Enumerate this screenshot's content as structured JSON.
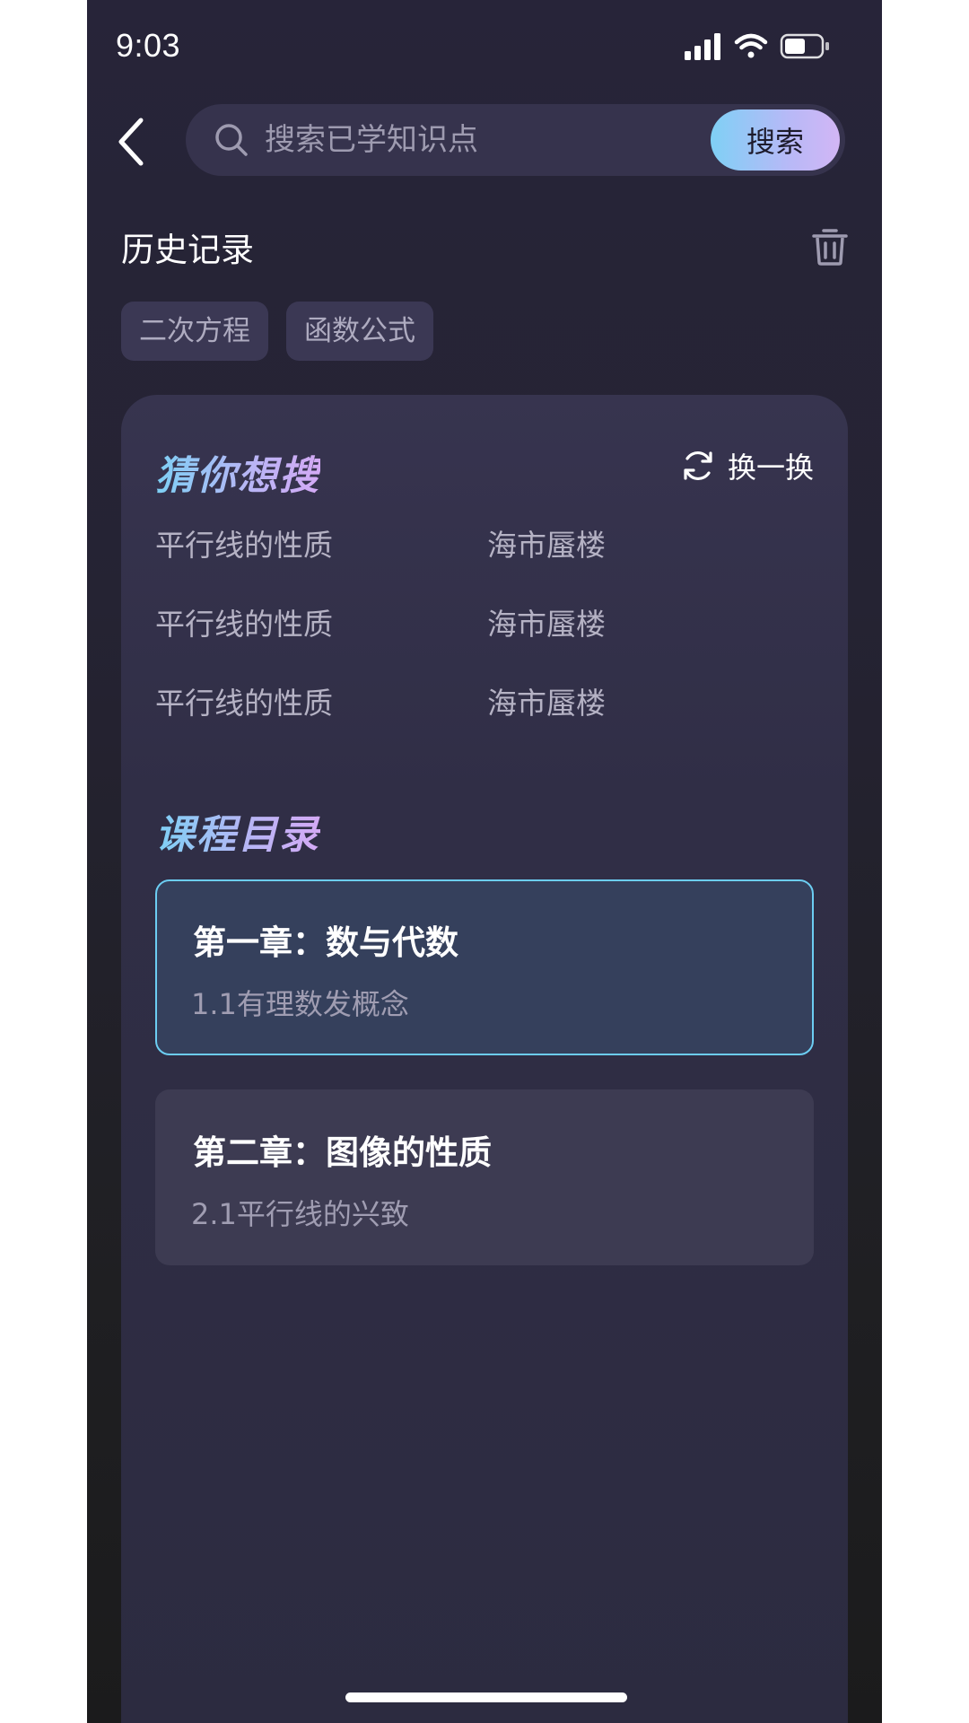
{
  "status_bar": {
    "time": "9:03"
  },
  "search": {
    "placeholder": "搜索已学知识点",
    "button_label": "搜索"
  },
  "history": {
    "title": "历史记录",
    "tags": [
      "二次方程",
      "函数公式"
    ]
  },
  "suggestions": {
    "title": "猜你想搜",
    "refresh_label": "换一换",
    "items": [
      "平行线的性质",
      "海市蜃楼",
      "平行线的性质",
      "海市蜃楼",
      "平行线的性质",
      "海市蜃楼"
    ]
  },
  "catalog": {
    "title": "课程目录",
    "chapters": [
      {
        "title": "第一章：数与代数",
        "subtitle": "1.1有理数发概念",
        "selected": true
      },
      {
        "title": "第二章：图像的性质",
        "subtitle": "2.1平行线的兴致",
        "selected": false
      }
    ]
  },
  "colors": {
    "background": "#272439",
    "card": "#37344f",
    "accent_start": "#7dd0f5",
    "accent_end": "#d4a9f5",
    "selected_border": "#6ccdf2"
  },
  "icons": [
    "back-chevron-icon",
    "search-icon",
    "trash-icon",
    "refresh-icon",
    "signal-icon",
    "wifi-icon",
    "battery-icon"
  ]
}
